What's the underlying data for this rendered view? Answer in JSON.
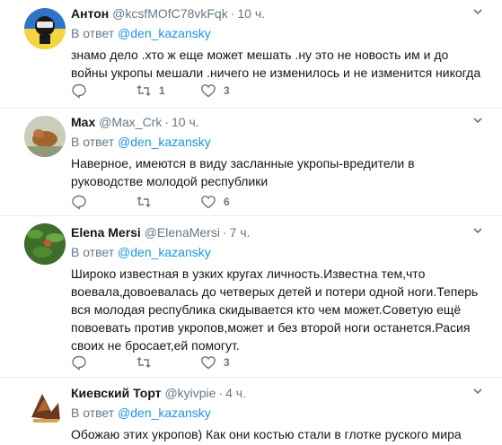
{
  "reply_prefix": "В ответ",
  "tweets": [
    {
      "name": "Антон",
      "handle": "@kcsfMOfC78vkFqk",
      "time": "10 ч.",
      "reply_to": "@den_kazansky",
      "text": "знамо дело .хто ж еще может мешать .ну это не новость им и до войны укропы мешали .ничего не изменилось и не изменится никогда",
      "reply_count": "",
      "retweet_count": "1",
      "like_count": "3"
    },
    {
      "name": "Max",
      "handle": "@Max_Crk",
      "time": "10 ч.",
      "reply_to": "@den_kazansky",
      "text": "Наверное, имеются в виду засланные укропы-вредители в руководстве молодой республики",
      "reply_count": "",
      "retweet_count": "",
      "like_count": "6"
    },
    {
      "name": "Elena Mersi",
      "handle": "@ElenaMersi",
      "time": "7 ч.",
      "reply_to": "@den_kazansky",
      "text": "Широко известная в узких кругах личность.Известна тем,что воевала,довоевалась до четверых детей и потери одной ноги.Теперь вся молодая республика скидывается кто чем может.Советую ещё повоевать против укропов,может и без второй ноги останется.Расия своих не бросает,ей помогут.",
      "reply_count": "",
      "retweet_count": "",
      "like_count": "3"
    },
    {
      "name": "Киевский Торт",
      "handle": "@kyivpie",
      "time": "4 ч.",
      "reply_to": "@den_kazansky",
      "text": "Обожаю этих укропов) Как они костью стали в глотке руского мира",
      "reply_count": "",
      "retweet_count": "",
      "like_count": ""
    }
  ],
  "colors": {
    "link": "#1b95e0",
    "secondary": "#657786",
    "divider": "#e6ecf0"
  }
}
